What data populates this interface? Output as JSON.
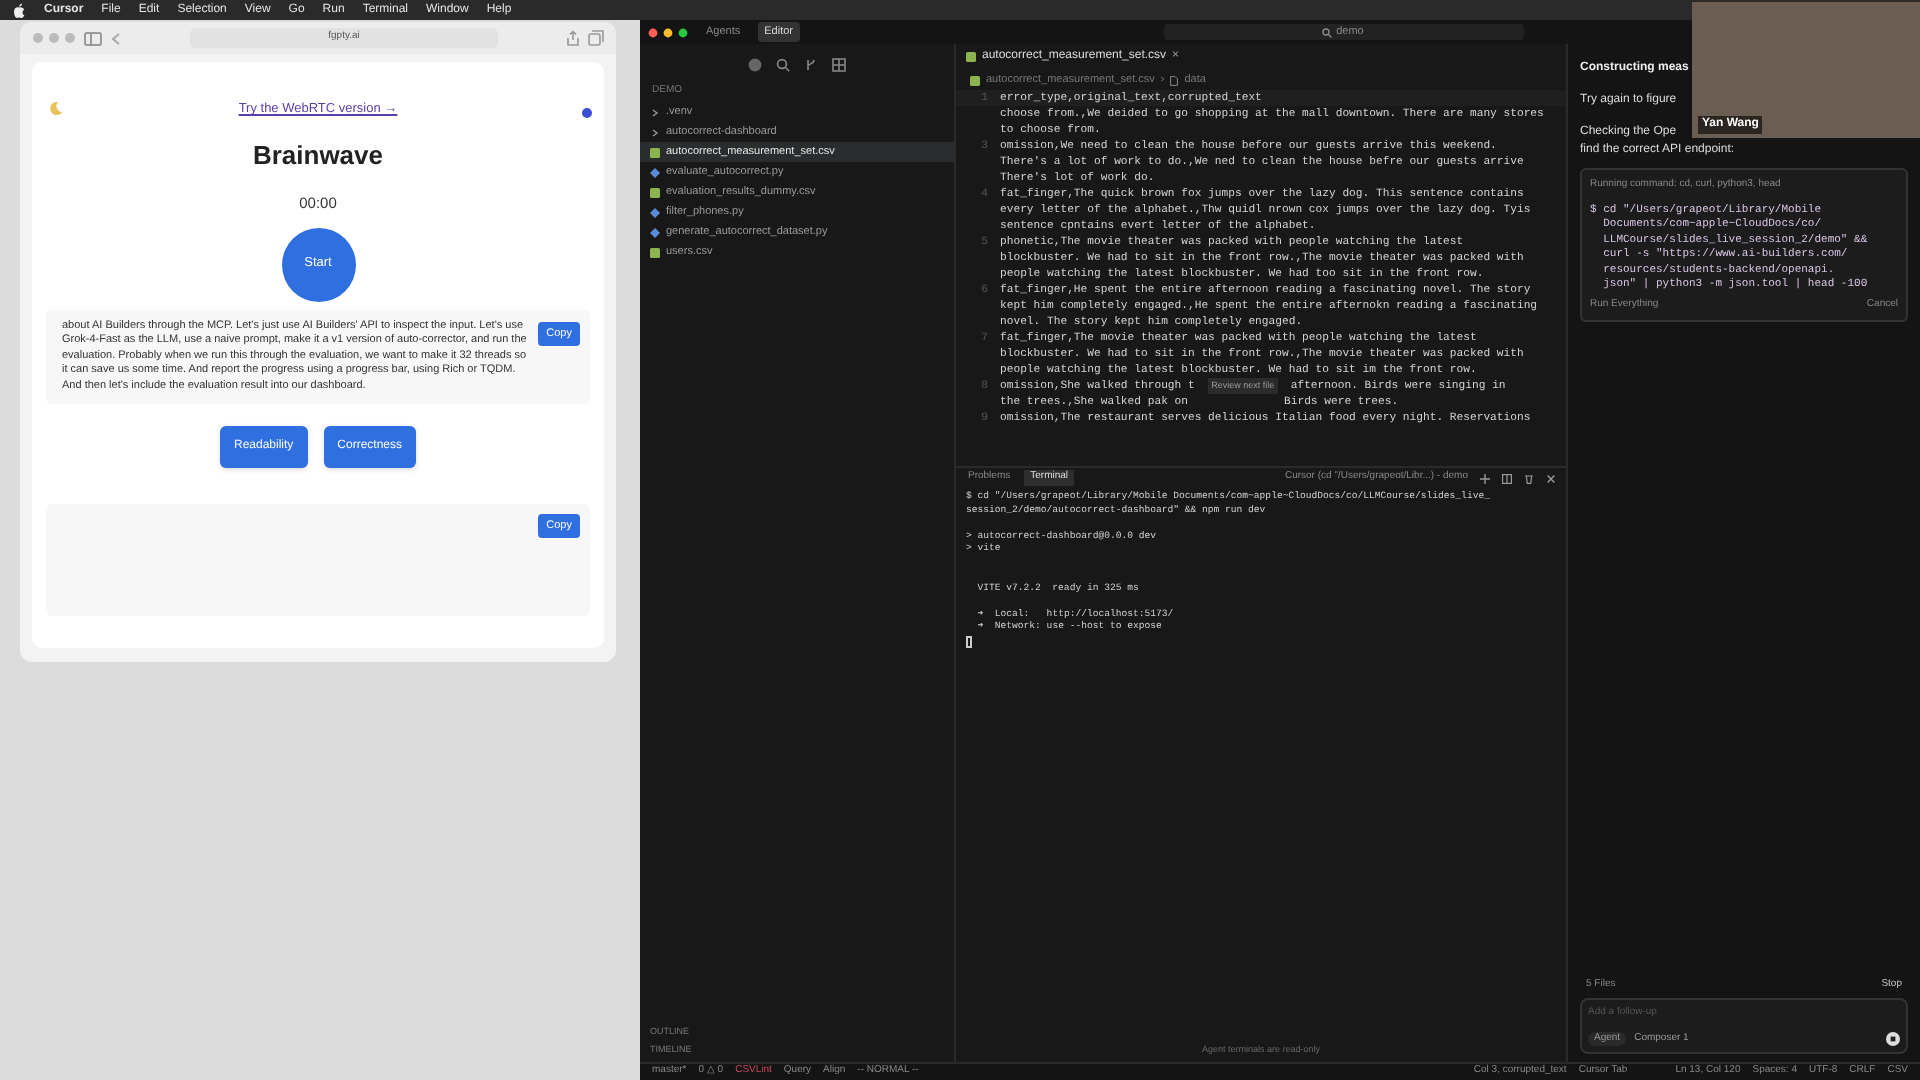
{
  "menubar": {
    "app": "Cursor",
    "items": [
      "File",
      "Edit",
      "Selection",
      "View",
      "Go",
      "Run",
      "Terminal",
      "Window",
      "Help"
    ]
  },
  "browser": {
    "url": "fgpty.ai",
    "link": "Try the WebRTC version →",
    "title": "Brainwave",
    "timer": "00:00",
    "start": "Start",
    "transcript": "about AI Builders through the MCP. Let's just use AI Builders' API to inspect the input. Let's use Grok-4-Fast as the LLM, use a naive prompt, make it a v1 version of auto-corrector, and run the evaluation. Probably when we run this through the evaluation, we want to make it 32 threads so it can save us some time. And report the progress using a progress bar, using Rich or TQDM. And then let's include the evaluation result into our dashboard.",
    "copy_buttons": [
      "Copy",
      "Copy"
    ],
    "actions": [
      "Readability",
      "Correctness"
    ]
  },
  "editor": {
    "tabs": [
      {
        "label": "Agents",
        "selected": false
      },
      {
        "label": "Editor",
        "selected": true
      }
    ],
    "search": "demo",
    "explorer": {
      "root": "DEMO",
      "items": [
        {
          "name": ".venv",
          "kind": "folder",
          "selected": false
        },
        {
          "name": "autocorrect-dashboard",
          "kind": "folder",
          "selected": false
        },
        {
          "name": "autocorrect_measurement_set.csv",
          "kind": "csv",
          "selected": true
        },
        {
          "name": "evaluate_autocorrect.py",
          "kind": "py",
          "selected": false
        },
        {
          "name": "evaluation_results_dummy.csv",
          "kind": "csv",
          "selected": false
        },
        {
          "name": "filter_phones.py",
          "kind": "py",
          "selected": false
        },
        {
          "name": "generate_autocorrect_dataset.py",
          "kind": "py",
          "selected": false
        },
        {
          "name": "users.csv",
          "kind": "csv",
          "selected": false
        }
      ],
      "sections": [
        "OUTLINE",
        "TIMELINE"
      ]
    },
    "file_tab": "autocorrect_measurement_set.csv",
    "close": "×",
    "breadcrumb": [
      "autocorrect_measurement_set.csv",
      "data"
    ],
    "breadcrumb_separator": "›",
    "sticky": {
      "number": "1",
      "text": "error_type,original_text,corrupted_text"
    },
    "rows": [
      {
        "lines": [
          [
            "choose from.,We deided to go shopping at the mall downtown. There are many stores"
          ],
          [
            "to choose from."
          ]
        ]
      },
      {
        "number": "3",
        "lines": [
          [
            "omission,We need to clean the house before our guests arrive this weekend."
          ],
          [
            "There's a lot of work to do.,We ned to clean the house befre our guests arrive"
          ],
          [
            "There's lot of work do."
          ]
        ]
      },
      {
        "number": "4",
        "lines": [
          [
            "fat_finger,The quick brown fox jumps over the lazy dog. This sentence contains"
          ],
          [
            "every letter of the alphabet.,Thw quidl nrown cox jumps over the lazy dog. Tyis"
          ],
          [
            "sentence cpntains evert letter of the alphabet."
          ]
        ]
      },
      {
        "number": "5",
        "lines": [
          [
            "phonetic,The movie theater was packed with people watching the latest"
          ],
          [
            "blockbuster. We had to sit in the front row.,The movie theater was packed with"
          ],
          [
            "people watching the latest blockbuster. We had too sit in the front row."
          ]
        ]
      },
      {
        "number": "6",
        "lines": [
          [
            "fat_finger,He spent the entire afternoon reading a fascinating novel. The story"
          ],
          [
            "kept him completely engaged.,He spent the entire afternokn reading a fascinating"
          ],
          [
            "novel. The story kept him completely engaged."
          ]
        ]
      },
      {
        "number": "7",
        "lines": [
          [
            "fat_finger,The movie theater was packed with people watching the latest"
          ],
          [
            "blockbuster. We had to sit in the front row.,The movie theater was packed with"
          ],
          [
            "people watching the latest blockbuster. We had to sit im the front row."
          ]
        ]
      },
      {
        "number": "8",
        "tooltip": "Review next file",
        "lines": [
          [
            "omission,She walked through t",
            "afternoon. Birds were singing in"
          ],
          [
            "the trees.,She walked pak on",
            "Birds were trees."
          ]
        ]
      },
      {
        "number": "9",
        "lines": [
          [
            "omission,The restaurant serves delicious Italian food every night. Reservations"
          ]
        ]
      }
    ],
    "terminal": {
      "tabs": [
        {
          "label": "Problems",
          "selected": false
        },
        {
          "label": "Terminal",
          "selected": true
        }
      ],
      "title": "Cursor (cd \"/Users/grapeot/Libr...) - demo",
      "output": "$ cd \"/Users/grapeot/Library/Mobile Documents/com~apple~CloudDocs/co/LLMCourse/slides_live_\nsession_2/demo/autocorrect-dashboard\" && npm run dev\n\n> autocorrect-dashboard@0.0.0 dev\n> vite\n\n\n  VITE v7.2.2  ready in 325 ms\n\n  ➜  Local:   http://localhost:5173/\n  ➜  Network: use --host to expose"
    },
    "notice": "Agent terminals are read-only",
    "status_left": [
      "master*",
      "0 △ 0",
      "CSVLint",
      "Query",
      "Align",
      "-- NORMAL --"
    ],
    "status_right": [
      "Col 3, corrupted_text",
      "Cursor Tab"
    ]
  },
  "agent": {
    "heading": "Constructing meas",
    "lines": [
      "Try again to figure",
      "Checking the Ope",
      "find the correct API endpoint:"
    ],
    "command": {
      "label": "Running command: cd, curl, python3, head",
      "code": "$ cd \"/Users/grapeot/Library/Mobile\n  Documents/com~apple~CloudDocs/co/\n  LLMCourse/slides_live_session_2/demo\" &&\n  curl -s \"https://www.ai-builders.com/\n  resources/students-backend/openapi.\n  json\" | python3 -m json.tool | head -100",
      "run": "Run Everything",
      "cancel": "Cancel"
    },
    "files": "5 Files",
    "stop": "Stop",
    "placeholder": "Add a follow-up",
    "mode": "Agent",
    "model": "Composer 1",
    "status": [
      "Ln 13, Col 120",
      "Spaces: 4",
      "UTF-8",
      "CRLF",
      "CSV"
    ]
  },
  "video": {
    "name": "Yan Wang"
  }
}
